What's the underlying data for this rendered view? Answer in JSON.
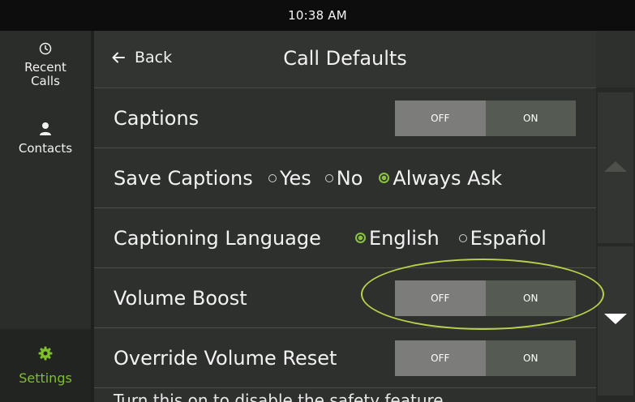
{
  "status_bar": {
    "time": "10:38 AM"
  },
  "sidebar": {
    "items": [
      {
        "label_line1": "Recent",
        "label_line2": "Calls",
        "icon": "clock-icon"
      },
      {
        "label": "Contacts",
        "icon": "person-icon"
      },
      {
        "label": "Settings",
        "icon": "gear-icon",
        "selected": true
      }
    ]
  },
  "header": {
    "back_label": "Back",
    "title": "Call Defaults"
  },
  "settings": {
    "captions": {
      "label": "Captions",
      "off_label": "OFF",
      "on_label": "ON"
    },
    "save_captions": {
      "label": "Save Captions",
      "options": [
        "Yes",
        "No",
        "Always Ask"
      ],
      "selected": "Always Ask"
    },
    "captioning_language": {
      "label": "Captioning Language",
      "options": [
        "English",
        "Español"
      ],
      "selected": "English"
    },
    "volume_boost": {
      "label": "Volume Boost",
      "off_label": "OFF",
      "on_label": "ON"
    },
    "override_volume_reset": {
      "label": "Override Volume Reset",
      "off_label": "OFF",
      "on_label": "ON"
    }
  },
  "partial_text": "Turn this on to disable the safety feature...",
  "colors": {
    "accent": "#8ac43f",
    "highlight": "#b6d14a",
    "toggle_off": "#7c7d7a",
    "toggle_on": "#555a52"
  }
}
